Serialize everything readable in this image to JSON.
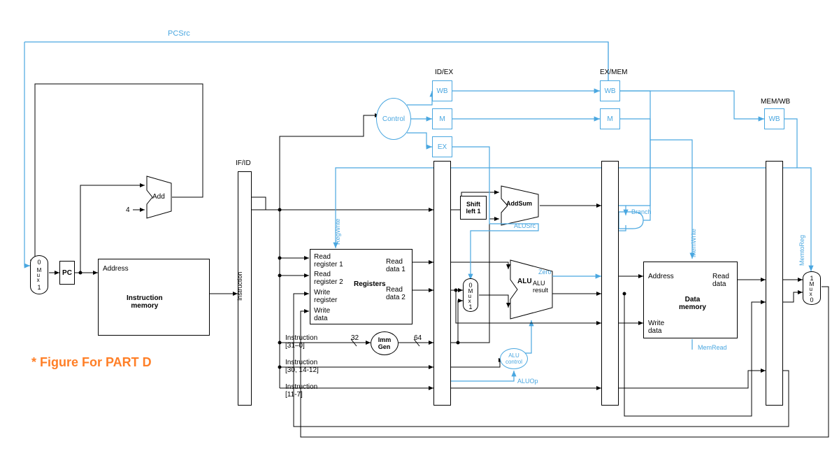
{
  "signals": {
    "pcsrc": "PCSrc",
    "regwrite": "RegWrite",
    "alusrc": "ALUSrc",
    "memwrite": "MemWrite",
    "memread": "MemRead",
    "memtoreg": "MemtoReg",
    "branch": "Branch",
    "aluop": "ALUOp",
    "instruction_side": "Instruction"
  },
  "pipeline": {
    "if_id": "IF/ID",
    "id_ex": "ID/EX",
    "ex_mem": "EX/MEM",
    "mem_wb": "MEM/WB"
  },
  "ctrl": {
    "WB": "WB",
    "M": "M",
    "EX": "EX",
    "control": "Control"
  },
  "blocks": {
    "pc": "PC",
    "add": "Add",
    "four": "4",
    "address": "Address",
    "imem": "Instruction\nmemory",
    "shift": "Shift\nleft 1",
    "addsum": "AddSum",
    "alu": "ALU",
    "zero": "Zero",
    "alu_result": "ALU\nresult",
    "alu_control": "ALU\ncontrol",
    "dmem": "Data\nmemory",
    "address2": "Address",
    "read_data": "Read\ndata",
    "write_data2": "Write\ndata",
    "immgen": "Imm\nGen"
  },
  "regfile": {
    "rr1": "Read\nregister 1",
    "rr2": "Read\nregister 2",
    "title": "Registers",
    "wr": "Write\nregister",
    "wd": "Write\ndata",
    "rd1": "Read\ndata 1",
    "rd2": "Read\ndata 2"
  },
  "instr_fields": {
    "f1": "Instruction\n[31–0]",
    "f2": "Instruction\n[30, 14-12]",
    "f3": "Instruction\n[11-7]",
    "w32": "32",
    "w64": "64"
  },
  "mux": {
    "label": "M\nu\nx",
    "zero": "0",
    "one": "1"
  },
  "caption": "* Figure For PART D"
}
